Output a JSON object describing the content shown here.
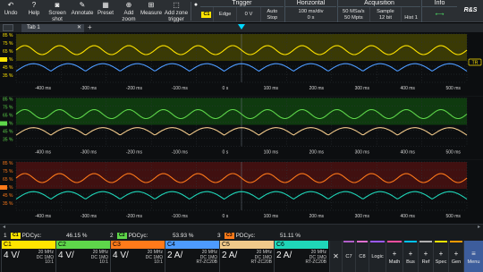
{
  "toolbar": {
    "buttons": [
      {
        "label": "Undo",
        "icon": "undo-icon"
      },
      {
        "label": "Help",
        "icon": "help-icon"
      },
      {
        "label": "Screen\nshot",
        "icon": "camera-icon"
      },
      {
        "label": "Annotate",
        "icon": "pen-icon"
      },
      {
        "label": "Preset",
        "icon": "preset-icon"
      },
      {
        "label": "Add\nzoom",
        "icon": "zoom-icon"
      },
      {
        "label": "Measure",
        "icon": "measure-icon"
      },
      {
        "label": "Add zone\ntrigger",
        "icon": "zone-trigger-icon"
      }
    ],
    "trigger": {
      "title": "Trigger",
      "channel": "C1",
      "type": "Edge",
      "level": "0 V",
      "mode": "Auto",
      "state": "Stop"
    },
    "horizontal": {
      "title": "Horizontal",
      "timebase": "100 ms/div",
      "position": "0 s"
    },
    "acquisition": {
      "title": "Acquisition",
      "sample_rate": "50 MSa/s",
      "record_length": "50 Mpts",
      "mode": "Sample",
      "resolution": "12 bit",
      "history": "Hist 1"
    },
    "info": {
      "title": "Info"
    },
    "brand": "R&S"
  },
  "diagram": {
    "tab_label": "Tab 1",
    "panels": [
      {
        "name": "top",
        "bg": "#3a3a05",
        "accent": "#ffe400",
        "waves": [
          {
            "color": "#ffe400"
          },
          {
            "color": "#4d9bff"
          }
        ]
      },
      {
        "name": "middle",
        "bg": "#0f3a0f",
        "accent": "#5ed64a",
        "waves": [
          {
            "color": "#5ed64a"
          },
          {
            "color": "#f0c98a"
          }
        ]
      },
      {
        "name": "bottom",
        "bg": "#401010",
        "accent": "#ff7a1a",
        "waves": [
          {
            "color": "#ff7a1a"
          },
          {
            "color": "#1fd6b8"
          }
        ]
      }
    ],
    "y_labels": [
      "85 %",
      "75 %",
      "65 %",
      "55 %",
      "45 %",
      "35 %"
    ],
    "x_labels": [
      "-400 ms",
      "-300 ms",
      "-200 ms",
      "-100 ms",
      "0 s",
      "100 ms",
      "200 ms",
      "300 ms",
      "400 ms",
      "500 ms"
    ],
    "ref_label": "TR"
  },
  "measurements": [
    {
      "index": "1",
      "channel": "C1",
      "color": "#ffe400",
      "name": "PDCyc:",
      "value": "46.15 %"
    },
    {
      "index": "2",
      "channel": "C2",
      "color": "#5ed64a",
      "name": "PDCyc:",
      "value": "53.93 %"
    },
    {
      "index": "3",
      "channel": "C3",
      "color": "#ff7a1a",
      "name": "PDCyc:",
      "value": "51.11 %"
    }
  ],
  "channels": [
    {
      "name": "C1",
      "color": "#ffe400",
      "scale": "4 V/",
      "bw": "20 MHz",
      "coupling": "DC 1MΩ",
      "probe": "10:1"
    },
    {
      "name": "C2",
      "color": "#5ed64a",
      "scale": "4 V/",
      "bw": "20 MHz",
      "coupling": "DC 1MΩ",
      "probe": "10:1"
    },
    {
      "name": "C3",
      "color": "#ff7a1a",
      "scale": "4 V/",
      "bw": "20 MHz",
      "coupling": "DC 1MΩ",
      "probe": "10:1"
    },
    {
      "name": "C4",
      "color": "#4d9bff",
      "scale": "2 A/",
      "bw": "20 MHz",
      "coupling": "DC 1MΩ",
      "probe": "RT-ZC20B"
    },
    {
      "name": "C5",
      "color": "#f0c98a",
      "scale": "2 A/",
      "bw": "20 MHz",
      "coupling": "DC 1MΩ",
      "probe": "RT-ZC20B"
    },
    {
      "name": "C6",
      "color": "#1fd6b8",
      "scale": "2 A/",
      "bw": "20 MHz",
      "coupling": "DC 1MΩ",
      "probe": "RT-ZC20B"
    }
  ],
  "right_buttons": [
    {
      "label": "",
      "icon": "close-icon",
      "strip": ""
    },
    {
      "label": "C7",
      "icon": "",
      "strip": "#b05ec9"
    },
    {
      "label": "C8",
      "icon": "",
      "strip": "#e070d0"
    },
    {
      "label": "Logic",
      "icon": "",
      "strip": "#9b59ff"
    },
    {
      "label": "Math",
      "icon": "plus-icon",
      "strip": "#ff4fa0"
    },
    {
      "label": "Bus",
      "icon": "plus-icon",
      "strip": "#00c2ff"
    },
    {
      "label": "Ref",
      "icon": "plus-icon",
      "strip": "#b0b0b0"
    },
    {
      "label": "Spec",
      "icon": "plus-icon",
      "strip": "#ffe400"
    },
    {
      "label": "Gen",
      "icon": "plus-icon",
      "strip": "#ff9a00"
    },
    {
      "label": "Menu",
      "icon": "menu-icon",
      "strip": ""
    }
  ]
}
